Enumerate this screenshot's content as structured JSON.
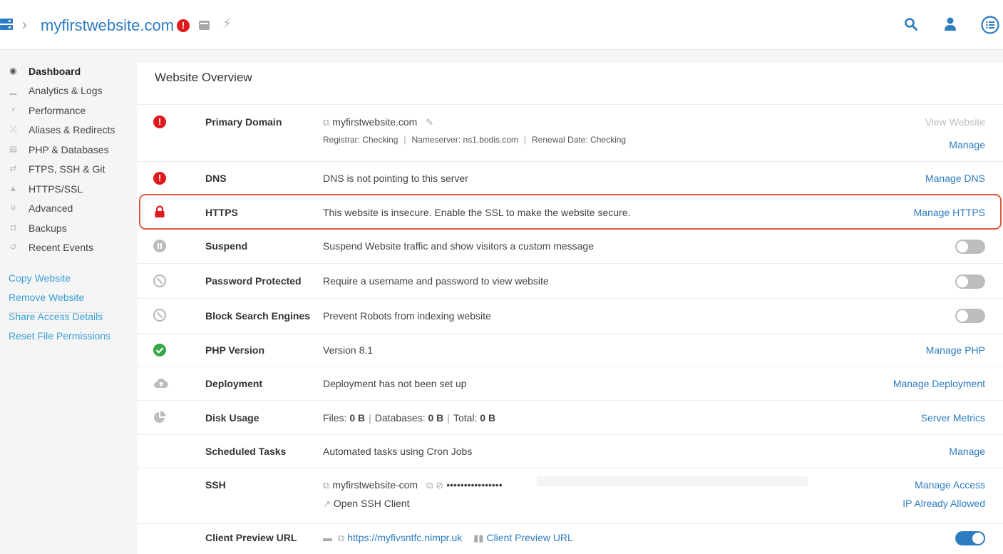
{
  "header": {
    "site_title": "myfirstwebsite.com",
    "alert_glyph": "!",
    "chevron": "›",
    "icons": [
      "server-icon",
      "alert-icon",
      "card-icon",
      "bolt-icon",
      "search-icon",
      "user-icon",
      "list-menu-icon"
    ]
  },
  "sidebar": {
    "nav": [
      {
        "label": "Dashboard",
        "icon": "dashboard-icon",
        "glyph": "◉"
      },
      {
        "label": "Analytics & Logs",
        "icon": "chart-icon",
        "glyph": "▁"
      },
      {
        "label": "Performance",
        "icon": "bolt-icon",
        "glyph": "⚡"
      },
      {
        "label": "Aliases & Redirects",
        "icon": "shuffle-icon",
        "glyph": "⤨"
      },
      {
        "label": "PHP & Databases",
        "icon": "database-icon",
        "glyph": "▤"
      },
      {
        "label": "FTPS, SSH & Git",
        "icon": "transfer-icon",
        "glyph": "⇄"
      },
      {
        "label": "HTTPS/SSL",
        "icon": "lock-icon",
        "glyph": "▲"
      },
      {
        "label": "Advanced",
        "icon": "advanced-icon",
        "glyph": "⊌"
      },
      {
        "label": "Backups",
        "icon": "camera-icon",
        "glyph": "◘"
      },
      {
        "label": "Recent Events",
        "icon": "history-icon",
        "glyph": "↺"
      }
    ],
    "actions": [
      "Copy Website",
      "Remove Website",
      "Share Access Details",
      "Reset File Permissions"
    ]
  },
  "main": {
    "title": "Website Overview",
    "primary_domain": {
      "label": "Primary Domain",
      "domain": "myfirstwebsite.com",
      "registrar": "Registrar: Checking",
      "nameserver": "Nameserver: ns1.bodis.com",
      "renewal": "Renewal Date: Checking",
      "action_view": "View Website",
      "action_manage": "Manage"
    },
    "dns": {
      "label": "DNS",
      "desc": "DNS is not pointing to this server",
      "action": "Manage DNS"
    },
    "https": {
      "label": "HTTPS",
      "desc": "This website is insecure. Enable the SSL to make the website secure.",
      "action": "Manage HTTPS"
    },
    "suspend": {
      "label": "Suspend",
      "desc": "Suspend Website traffic and show visitors a custom message",
      "enabled": false
    },
    "password": {
      "label": "Password Protected",
      "desc": "Require a username and password to view website",
      "enabled": false
    },
    "block_search": {
      "label": "Block Search Engines",
      "desc": "Prevent Robots from indexing website",
      "enabled": false
    },
    "php": {
      "label": "PHP Version",
      "desc": "Version 8.1",
      "action": "Manage PHP"
    },
    "deployment": {
      "label": "Deployment",
      "desc": "Deployment has not been set up",
      "action": "Manage Deployment"
    },
    "disk": {
      "label": "Disk Usage",
      "files_label": "Files:",
      "files_value": "0 B",
      "db_label": "Databases:",
      "db_value": "0 B",
      "total_label": "Total:",
      "total_value": "0 B",
      "action": "Server Metrics"
    },
    "scheduled": {
      "label": "Scheduled Tasks",
      "desc": "Automated tasks using Cron Jobs",
      "action": "Manage"
    },
    "ssh": {
      "label": "SSH",
      "username": "myfirstwebsite-com",
      "password_mask": "••••••••••••••••",
      "open_client": "Open SSH Client",
      "action_access": "Manage Access",
      "action_ip": "IP Already Allowed"
    },
    "preview": {
      "label": "Client Preview URL",
      "url": "https://myfivsntfc.nimpr.uk",
      "link_text": "Client Preview URL",
      "enabled": true
    }
  },
  "colors": {
    "accent": "#2d7cc1",
    "sidebar_link": "#3aa0d8",
    "error": "#e0191d",
    "success": "#3aa64a",
    "highlight_border": "#e05a3f"
  }
}
